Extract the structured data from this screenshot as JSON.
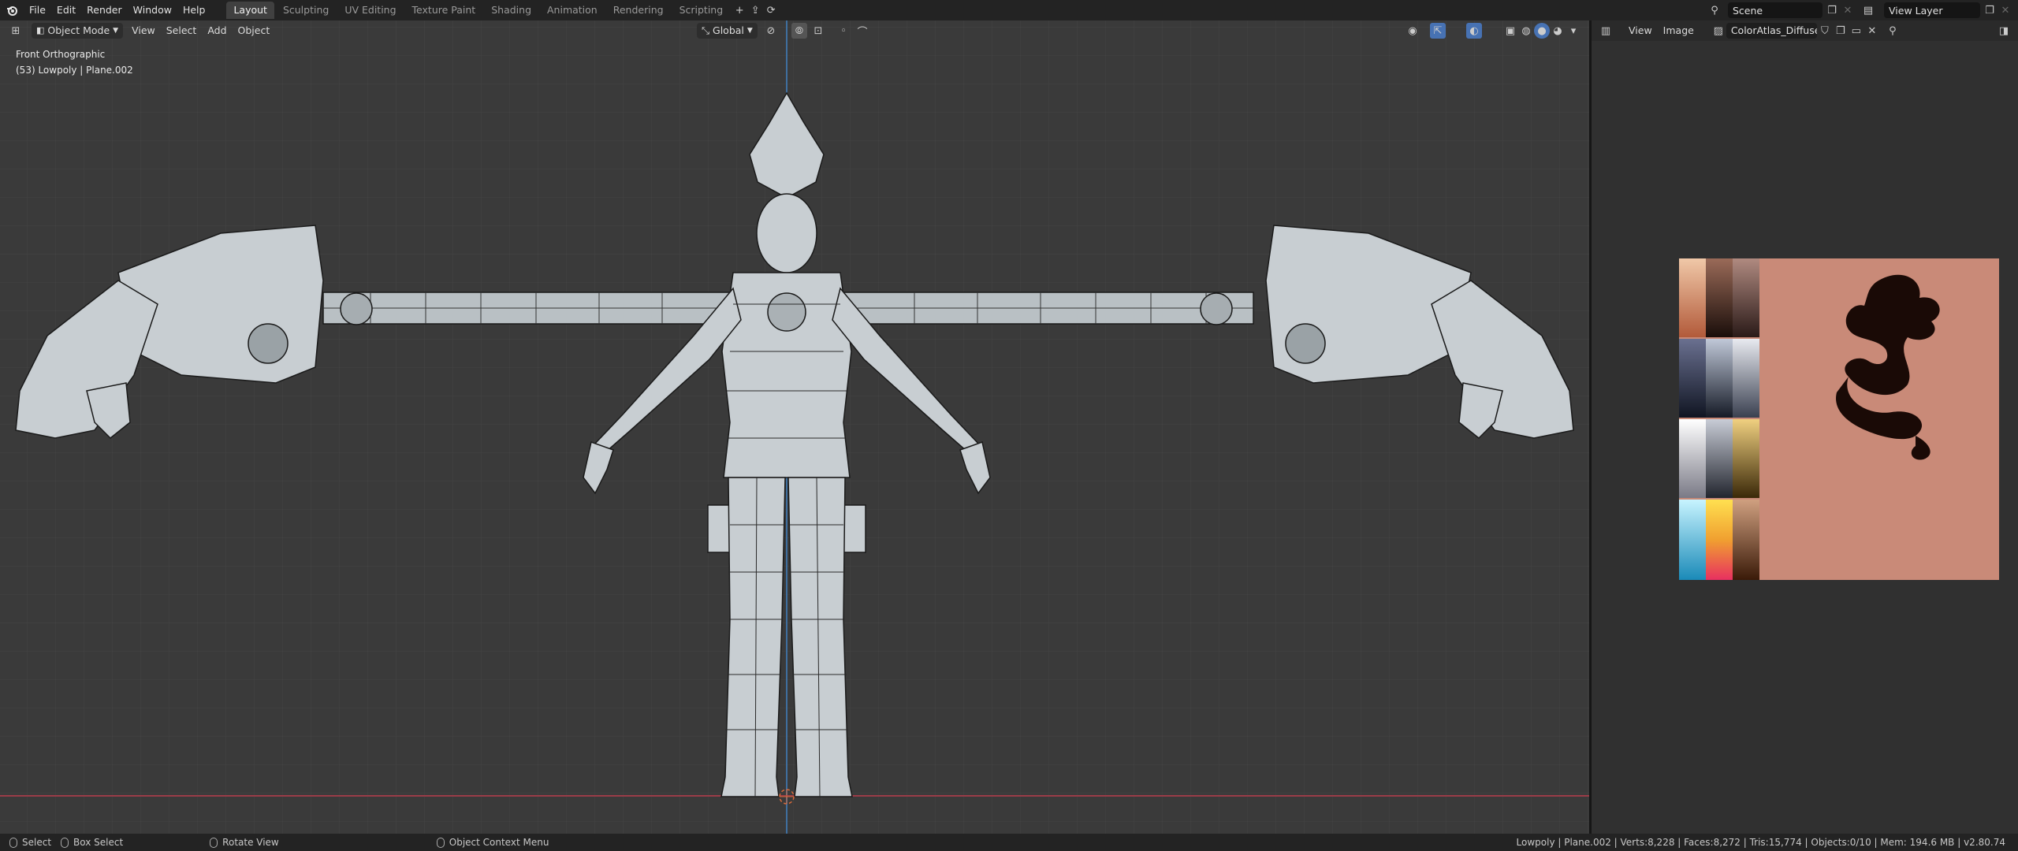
{
  "topbar": {
    "menus": [
      "File",
      "Edit",
      "Render",
      "Window",
      "Help"
    ],
    "workspaces": [
      "Layout",
      "Sculpting",
      "UV Editing",
      "Texture Paint",
      "Shading",
      "Animation",
      "Rendering",
      "Scripting"
    ],
    "active_workspace": "Layout",
    "scene": "Scene",
    "view_layer": "View Layer"
  },
  "viewport": {
    "mode": "Object Mode",
    "menus": [
      "View",
      "Select",
      "Add",
      "Object"
    ],
    "orientation": "Global",
    "view_name": "Front Orthographic",
    "object_info": "(53) Lowpoly | Plane.002"
  },
  "image_editor": {
    "menus": [
      "View",
      "Image"
    ],
    "image_name": "ColorAtlas_Diffuse.p...",
    "atlas_bg": "#c98a78"
  },
  "statusbar": {
    "select": "Select",
    "box_select": "Box Select",
    "rotate": "Rotate View",
    "context": "Object Context Menu",
    "stats": "Lowpoly | Plane.002 | Verts:8,228 | Faces:8,272 | Tris:15,774 | Objects:0/10 | Mem: 194.6 MB | v2.80.74"
  },
  "colors": {
    "accent": "#4772b3",
    "x_axis": "#a0404c",
    "z_axis": "#3f6f9f"
  }
}
